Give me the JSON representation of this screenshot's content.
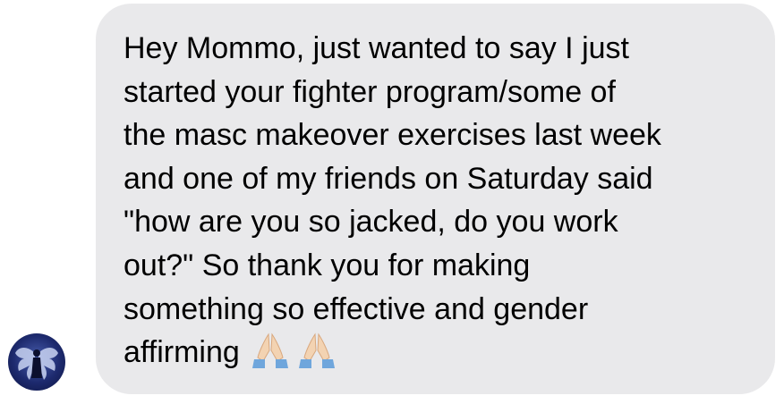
{
  "message": {
    "lines": [
      "Hey Mommo, just wanted to say I just",
      "started your fighter program/some of",
      "the masc makeover exercises last week",
      "and one of my friends on Saturday said",
      "\"how are you so jacked, do you work",
      "out?\" So thank you for making",
      "something so effective and gender",
      "affirming"
    ],
    "emojis": [
      "folded-hands-icon",
      "folded-hands-icon"
    ]
  },
  "colors": {
    "bubble": "#e9e9eb",
    "text": "#000000",
    "avatar_bg": "#1d2a6e"
  }
}
